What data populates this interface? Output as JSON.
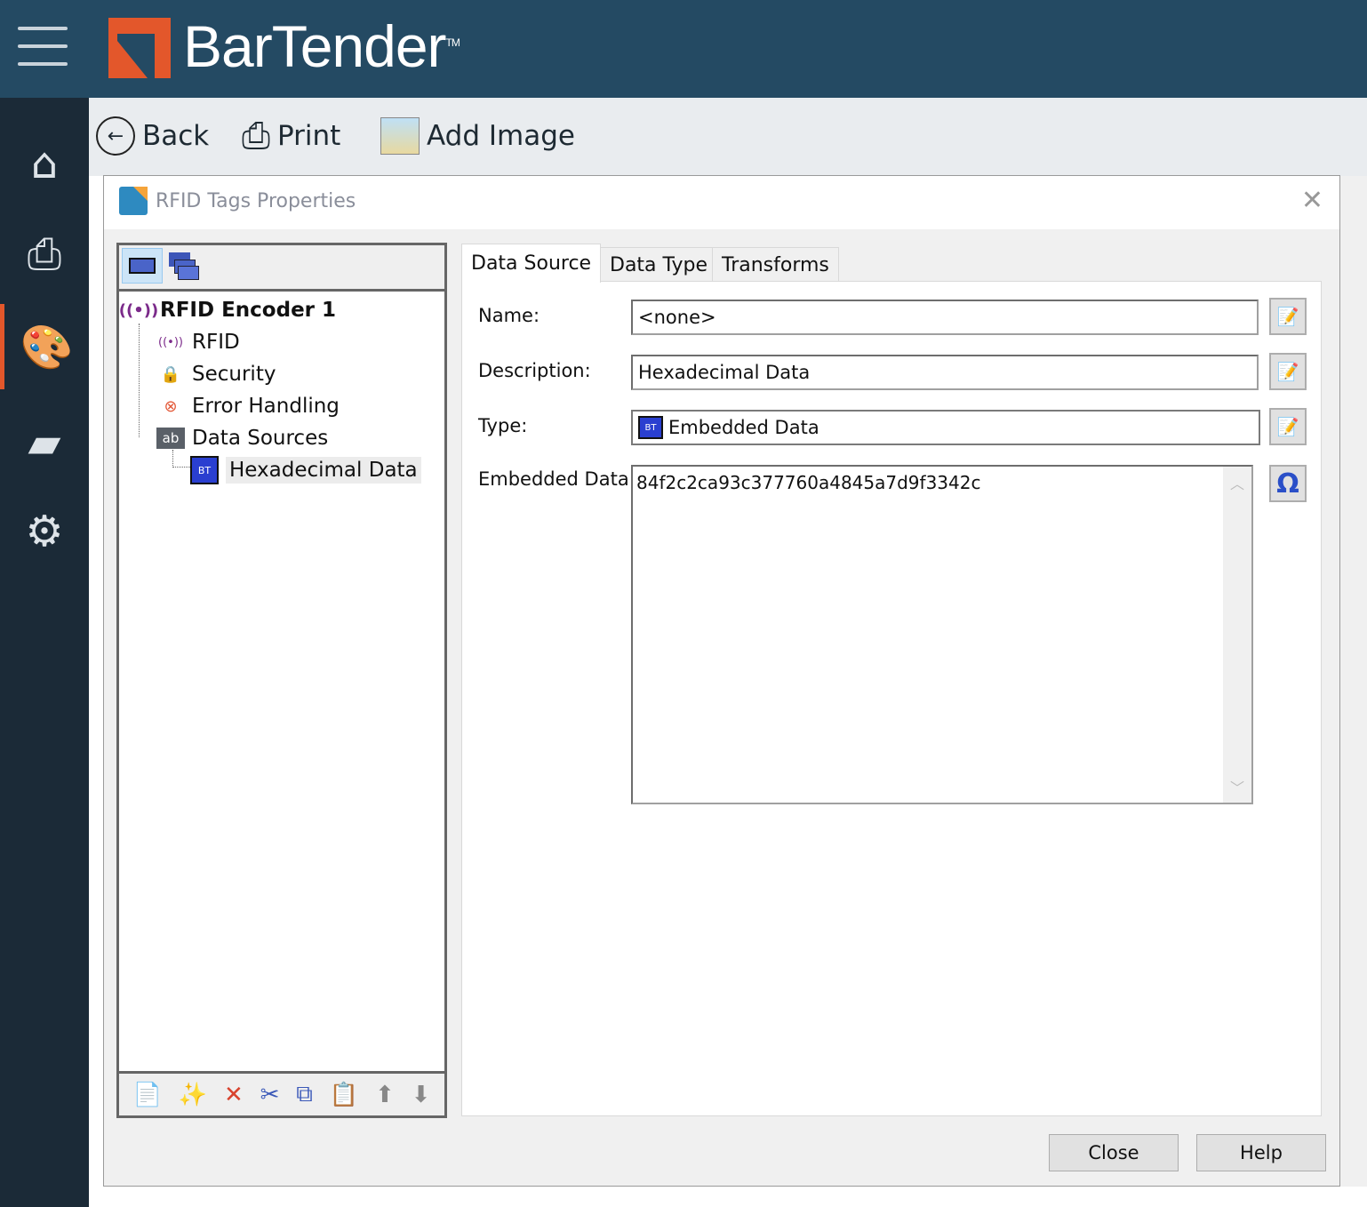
{
  "app": {
    "brand": "BarTender",
    "trademark": "TM"
  },
  "toolbar": {
    "back": "Back",
    "print": "Print",
    "add_image": "Add Image"
  },
  "dialog": {
    "title": "RFID Tags Properties",
    "tree": {
      "root": "RFID Encoder 1",
      "items": [
        "RFID",
        "Security",
        "Error Handling",
        "Data Sources"
      ],
      "child": "Hexadecimal Data",
      "data_sources_icon_text": "ab"
    },
    "tabs": [
      "Data Source",
      "Data Type",
      "Transforms"
    ],
    "fields": {
      "name_label": "Name:",
      "name_value": "<none>",
      "description_label": "Description:",
      "description_value": "Hexadecimal Data",
      "type_label": "Type:",
      "type_value": "Embedded Data",
      "embedded_label": "Embedded Data:",
      "embedded_value": "84f2c2ca93c377760a4845a7d9f3342c"
    },
    "buttons": {
      "close": "Close",
      "help": "Help"
    }
  },
  "colors": {
    "topbar": "#244a63",
    "sidebar": "#1b2a37",
    "accent": "#e3572b"
  }
}
